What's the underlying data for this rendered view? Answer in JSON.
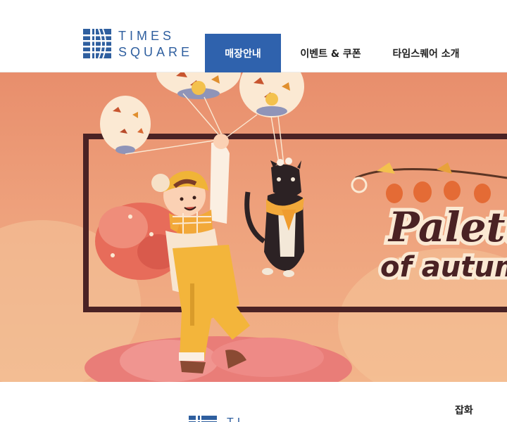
{
  "header": {
    "logo": {
      "line1": "TIMES",
      "line2": "SQUARE",
      "color": "#2f5f9f"
    },
    "nav": [
      {
        "label": "매장안내",
        "active": true
      },
      {
        "label": "이벤트 & 쿠폰",
        "active": false
      },
      {
        "label": "타임스퀘어 소개",
        "active": false
      },
      {
        "label": "",
        "active": false
      }
    ],
    "accent": "#2f62ad"
  },
  "banner": {
    "title_line1": "Palett",
    "title_line2": "of autum",
    "background": "#eea17c",
    "frame_color": "#4a2224"
  },
  "content_card": {
    "logo_text": "TIMES",
    "category": "잡화"
  }
}
